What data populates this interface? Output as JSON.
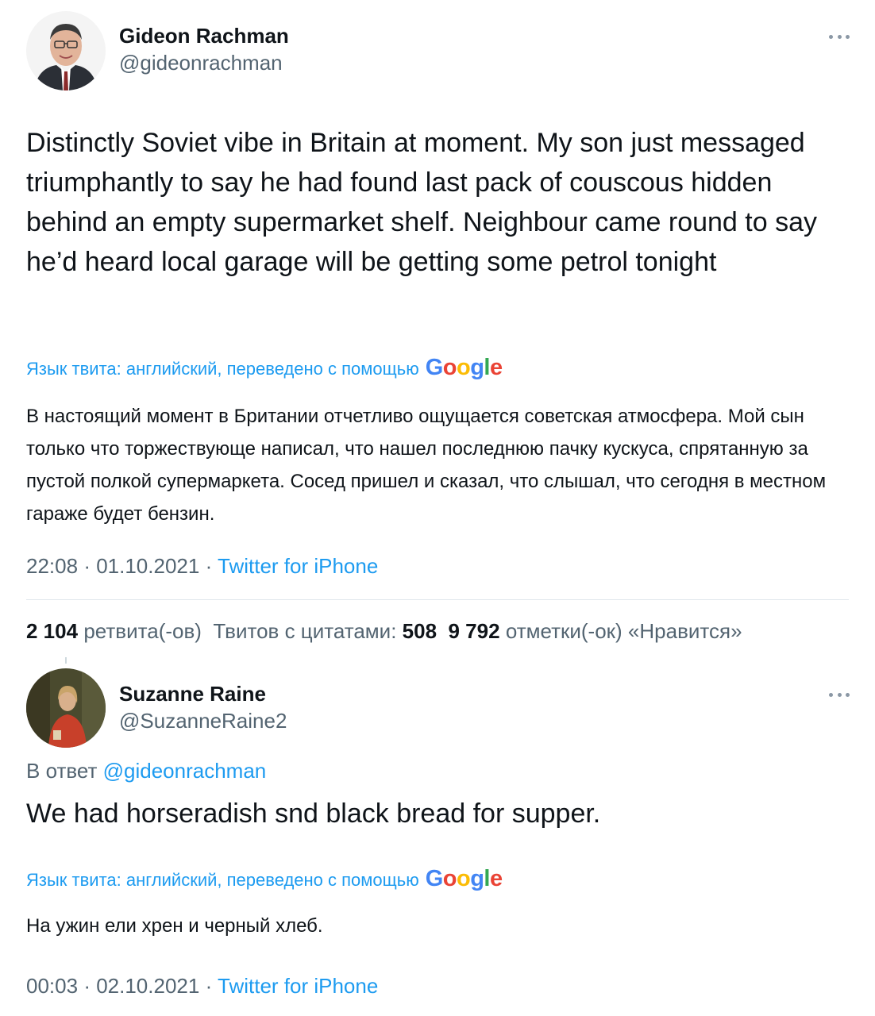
{
  "main_tweet": {
    "author_name": "Gideon Rachman",
    "author_handle": "@gideonrachman",
    "text": "Distinctly Soviet vibe in Britain at moment. My son just messaged triumphantly to say he had found last pack of couscous hidden behind an empty supermarket shelf. Neighbour came round to say he’d heard local garage will be getting some petrol tonight",
    "translation_label": "Язык твита: английский, переведено с помощью",
    "translation_provider": "Google",
    "translated_text": "В настоящий момент в Британии отчетливо ощущается советская атмосфера. Мой сын только что торжествующе написал, что нашел последнюю пачку кускуса, спрятанную за пустой полкой супермаркета. Сосед пришел и сказал, что слышал, что сегодня в местном гараже будет бензин.",
    "time": "22:08",
    "date": "01.10.2021",
    "source": "Twitter for iPhone",
    "stats": {
      "retweets_count": "2 104",
      "retweets_label": "ретвита(-ов)",
      "quotes_label": "Твитов с цитатами:",
      "quotes_count": "508",
      "likes_count": "9 792",
      "likes_label": "отметки(-ок) «Нравится»"
    }
  },
  "reply_tweet": {
    "author_name": "Suzanne Raine",
    "author_handle": "@SuzanneRaine2",
    "reply_prefix": "В ответ",
    "reply_mention": "@gideonrachman",
    "text": "We had horseradish snd black bread for supper.",
    "translation_label": "Язык твита: английский, переведено с помощью",
    "translation_provider": "Google",
    "translated_text": "На ужин ели хрен и черный хлеб.",
    "time": "00:03",
    "date": "02.10.2021",
    "source": "Twitter for iPhone"
  },
  "icons": {
    "more": "more-horizontal-icon",
    "google_logo": "google-logo"
  },
  "colors": {
    "link": "#1d9bf0",
    "secondary_text": "#536471",
    "primary_text": "#0f1419",
    "divider": "#e1e8ed"
  }
}
